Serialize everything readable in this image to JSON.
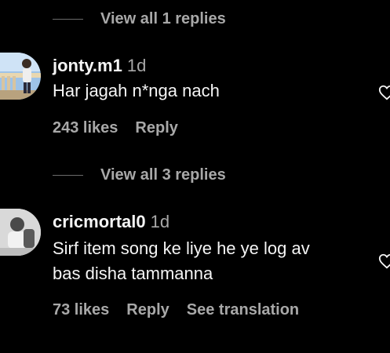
{
  "threads": [
    {
      "view_replies_label": "View all 1 replies"
    },
    {
      "view_replies_label": "View all 3 replies"
    }
  ],
  "comments": [
    {
      "username": "jonty.m1",
      "time": "1d",
      "lines": [
        "Har jagah n*nga nach"
      ],
      "likes": "243 likes",
      "reply_label": "Reply",
      "avatar_icon": "avatar-photo-icon"
    },
    {
      "username": "cricmortal0",
      "time": "1d",
      "lines": [
        "Sirf item song ke liye he ye log av",
        "bas disha tammanna"
      ],
      "likes": "73 likes",
      "reply_label": "Reply",
      "translation_label": "See translation",
      "avatar_icon": "avatar-photo-icon"
    }
  ],
  "colors": {
    "background": "#000000",
    "primary_text": "#f5f5f5",
    "secondary_text": "#a8a8a8",
    "divider": "#6b6b6b"
  }
}
